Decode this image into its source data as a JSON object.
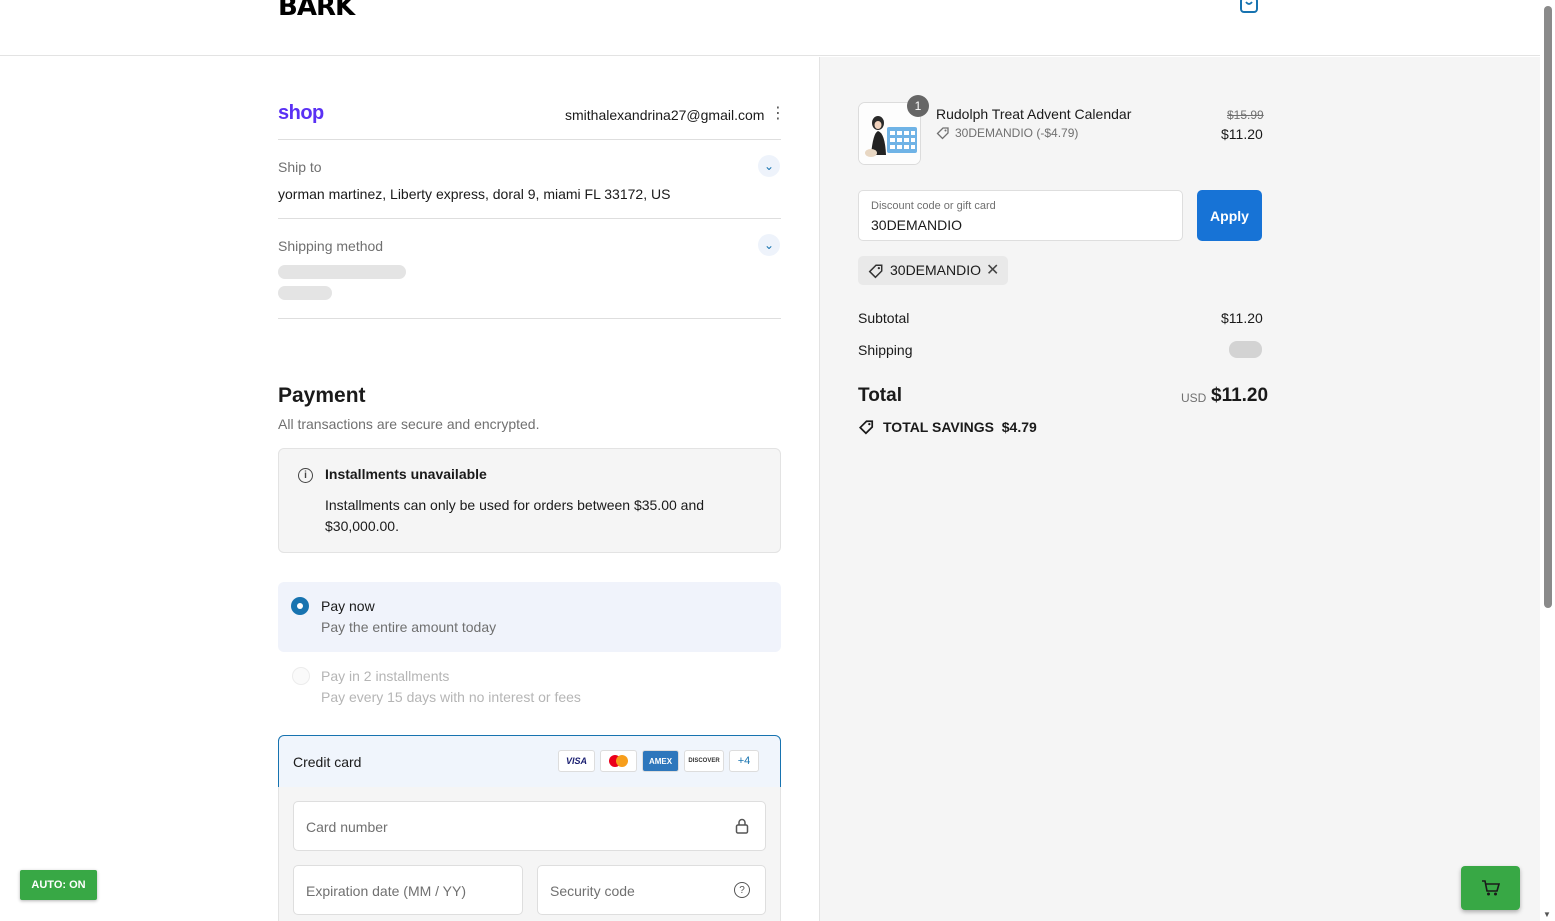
{
  "header": {
    "brand": "BARK",
    "cart_icon": "bag-icon"
  },
  "account": {
    "shop_brand": "shop",
    "email": "smithalexandrina27@gmail.com",
    "menu_icon": "kebab-icon"
  },
  "ship_to": {
    "label": "Ship to",
    "address": "yorman martinez, Liberty express, doral 9, miami FL 33172, US"
  },
  "shipping_method": {
    "label": "Shipping method"
  },
  "payment": {
    "title": "Payment",
    "subtitle": "All transactions are secure and encrypted.",
    "notice_title": "Installments unavailable",
    "notice_body": "Installments can only be used for orders between $35.00 and $30,000.00.",
    "options": [
      {
        "title": "Pay now",
        "subtitle": "Pay the entire amount today",
        "selected": true
      },
      {
        "title": "Pay in 2 installments",
        "subtitle": "Pay every 15 days with no interest or fees",
        "selected": false
      }
    ],
    "method_label": "Credit card",
    "card_brands": [
      "VISA",
      "MC",
      "AMEX",
      "DISCOVER",
      "+4"
    ],
    "card_number_placeholder": "Card number",
    "expiry_placeholder": "Expiration date (MM / YY)",
    "security_placeholder": "Security code"
  },
  "order": {
    "quantity": "1",
    "product_name": "Rudolph Treat Advent Calendar",
    "product_discount": "30DEMANDIO (-$4.79)",
    "price_original": "$15.99",
    "price_final": "$11.20",
    "discount_label": "Discount code or gift card",
    "discount_value": "30DEMANDIO",
    "apply_label": "Apply",
    "applied_code": "30DEMANDIO",
    "subtotal_label": "Subtotal",
    "subtotal_value": "$11.20",
    "shipping_label": "Shipping",
    "total_label": "Total",
    "currency": "USD",
    "total_value": "$11.20",
    "savings_label": "TOTAL SAVINGS",
    "savings_value": "$4.79"
  },
  "widgets": {
    "auto_label": "AUTO: ON",
    "cart_fab_icon": "cart-icon"
  },
  "colors": {
    "accent": "#1773b0",
    "apply": "#1773d6",
    "shop_purple": "#5a31f4",
    "widget_green": "#38a845"
  }
}
